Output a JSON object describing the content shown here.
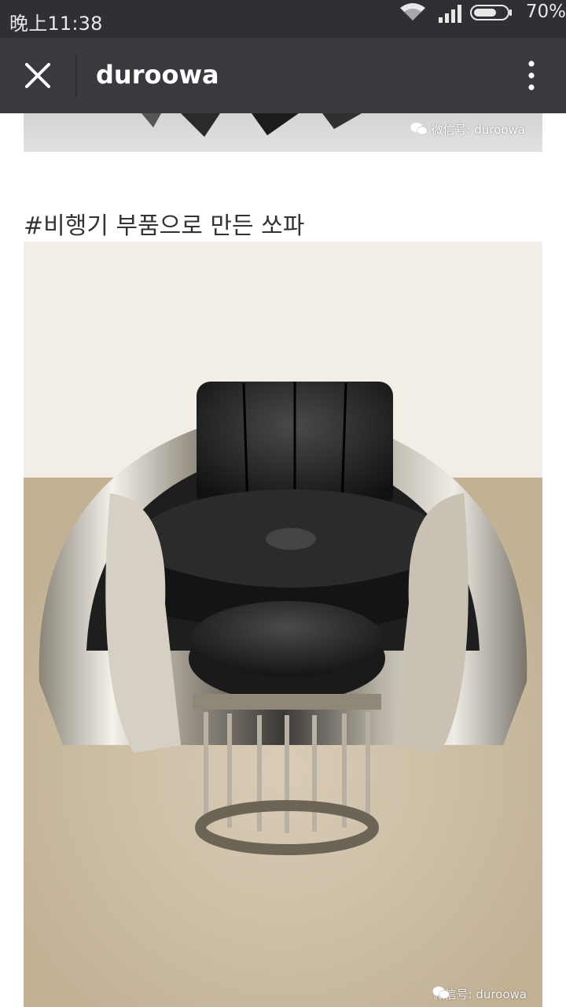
{
  "status_bar": {
    "time": "晚上11:38",
    "battery_percent": "70%",
    "battery_level": 0.7
  },
  "app_bar": {
    "title": "duroowa",
    "close_icon": "close-icon",
    "more_icon": "more-vertical-icon"
  },
  "article": {
    "prev_watermark": "微信号: duroowa",
    "heading": "#비행기 부품으로 만든 쏘파",
    "photo_watermark": "微信号: duroowa"
  },
  "colors": {
    "status_bar_bg": "#2f3033",
    "app_bar_bg": "#393a3f",
    "heading_text": "#333333"
  }
}
